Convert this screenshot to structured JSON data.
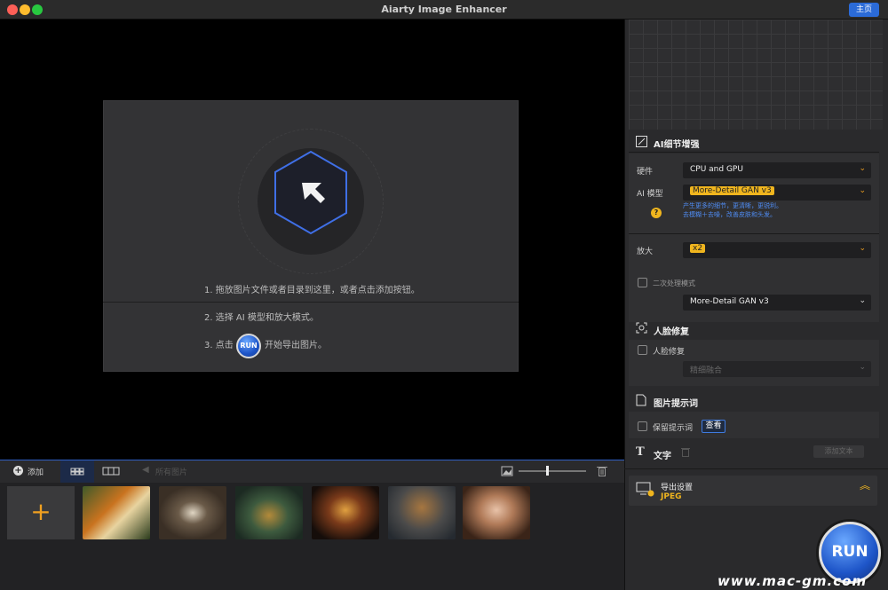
{
  "window": {
    "title": "Aiarty Image Enhancer",
    "home_label": "主页"
  },
  "dropzone": {
    "step1": "1. 拖放图片文件或者目录到这里，或者点击添加按钮。",
    "step2": "2. 选择 AI 模型和放大模式。",
    "step3_prefix": "3. 点击",
    "step3_run": "RUN",
    "step3_suffix": "开始导出图片。"
  },
  "toolbar": {
    "add_label": "添加",
    "all_images_label": "所有图片"
  },
  "thumbnails": [
    {
      "subject": "tiger"
    },
    {
      "subject": "butterfly"
    },
    {
      "subject": "bottle"
    },
    {
      "subject": "burger"
    },
    {
      "subject": "dog"
    },
    {
      "subject": "woman"
    }
  ],
  "panel": {
    "ai_detail": {
      "title": "AI细节增强",
      "hardware_label": "硬件",
      "hardware_value": "CPU and GPU",
      "model_label": "AI 模型",
      "model_value": "More-Detail GAN v3",
      "model_desc1": "产生更多的细节，更清晰，更锐利。",
      "model_desc2": "去模糊＋去噪，改善皮肤和头发。",
      "help": "?",
      "upscale_label": "放大",
      "upscale_value": "x2",
      "second_pass_label": "二次处理模式",
      "second_pass_value": "More-Detail GAN v3"
    },
    "face": {
      "title": "人脸修复",
      "checkbox_label": "人脸修复",
      "mode_value": "精细融合"
    },
    "prompt": {
      "title": "图片提示词",
      "checkbox_label": "保留提示词",
      "view_button": "查看"
    },
    "text": {
      "title": "文字",
      "add_button": "添加文本"
    },
    "export": {
      "title": "导出设置",
      "format": "JPEG"
    },
    "run_label": "RUN"
  },
  "watermark": "www.mac-gm.com",
  "colors": {
    "accent": "#f0b51e",
    "brand_blue": "#2b6bd8",
    "panel_bg": "#2a2a2c"
  }
}
